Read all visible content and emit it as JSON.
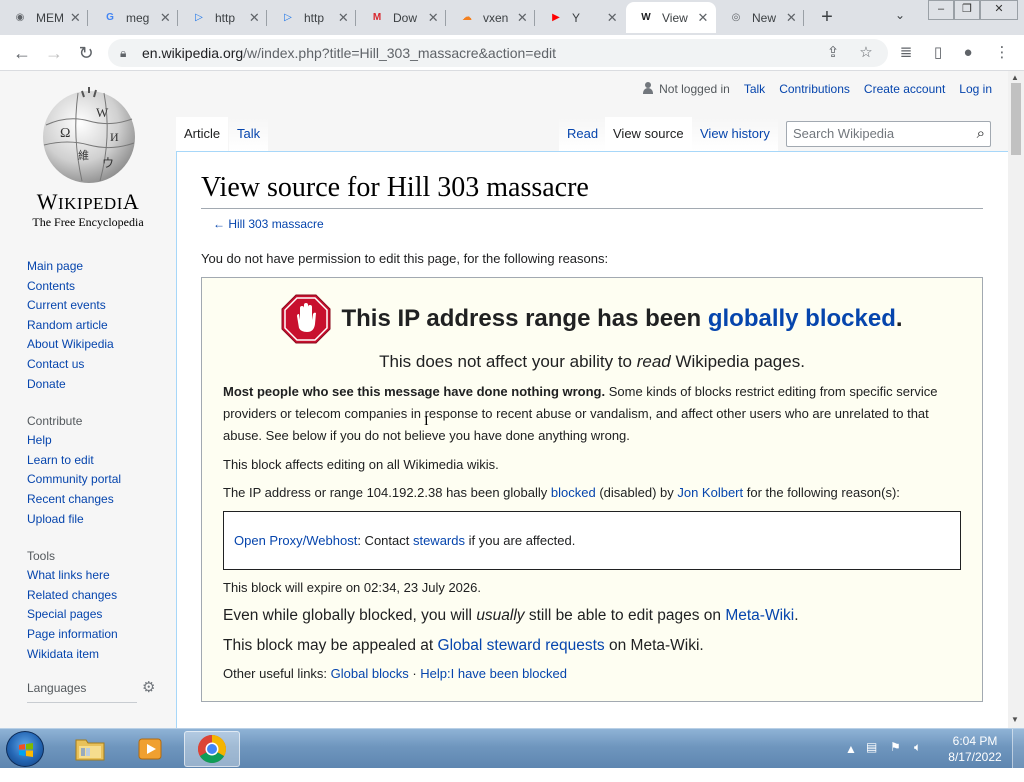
{
  "browser": {
    "tabs": [
      {
        "title": "MEM",
        "favicon": "github-icon",
        "color": "#5f6368",
        "glyph": "◉"
      },
      {
        "title": "meg",
        "favicon": "google-icon",
        "color": "#4285f4",
        "glyph": "G"
      },
      {
        "title": "http",
        "favicon": "play-icon",
        "color": "#1a73e8",
        "glyph": "▷"
      },
      {
        "title": "http",
        "favicon": "play-icon",
        "color": "#1a73e8",
        "glyph": "▷"
      },
      {
        "title": "Dow",
        "favicon": "mega-icon",
        "color": "#d9272e",
        "glyph": "M"
      },
      {
        "title": "vxen",
        "favicon": "cloudflare-icon",
        "color": "#f38020",
        "glyph": "☁"
      },
      {
        "title": "Y",
        "favicon": "youtube-icon",
        "color": "#ff0000",
        "glyph": "▶"
      },
      {
        "title": "View",
        "favicon": "wikipedia-icon",
        "color": "#202124",
        "glyph": "W"
      },
      {
        "title": "New",
        "favicon": "chrome-icon",
        "color": "#5f6368",
        "glyph": "◎"
      }
    ],
    "active_tab_index": 7,
    "url_host": "en.wikipedia.org",
    "url_rest": "/w/index.php?title=Hill_303_massacre&action=edit"
  },
  "wiki": {
    "personal": {
      "not_logged_in": "Not logged in",
      "talk": "Talk",
      "contributions": "Contributions",
      "create_account": "Create account",
      "log_in": "Log in"
    },
    "logo": {
      "wordmark_big": "W",
      "wordmark_rest": "IKIPEDI",
      "wordmark_a": "A",
      "tagline": "The Free Encyclopedia"
    },
    "nav": {
      "main": [
        "Main page",
        "Contents",
        "Current events",
        "Random article",
        "About Wikipedia",
        "Contact us",
        "Donate"
      ],
      "contribute_heading": "Contribute",
      "contribute": [
        "Help",
        "Learn to edit",
        "Community portal",
        "Recent changes",
        "Upload file"
      ],
      "tools_heading": "Tools",
      "tools": [
        "What links here",
        "Related changes",
        "Special pages",
        "Page information",
        "Wikidata item"
      ],
      "languages_heading": "Languages"
    },
    "tabs": {
      "article": "Article",
      "talk": "Talk",
      "read": "Read",
      "view_source": "View source",
      "view_history": "View history"
    },
    "search_placeholder": "Search Wikipedia",
    "title": "View source for Hill 303 massacre",
    "backlink": "← Hill 303 massacre",
    "intro": "You do not have permission to edit this page, for the following reasons:",
    "block": {
      "headline_pre": "This IP address range has been ",
      "headline_link": "globally blocked",
      "headline_post": ".",
      "sub_pre": "This does not affect your ability to ",
      "sub_em": "read",
      "sub_post": " Wikipedia pages.",
      "p1_bold": "Most people who see this message have done nothing wrong.",
      "p1_rest": " Some kinds of blocks restrict editing from specific service providers or telecom companies in response to recent abuse or vandalism, and affect other users who are unrelated to that abuse. See below if you do not believe you have done anything wrong.",
      "p2": "This block affects editing on all Wikimedia wikis.",
      "p3_pre": "The IP address or range 104.192.2.38 has been globally ",
      "p3_link1": "blocked",
      "p3_mid": " (disabled) by ",
      "p3_link2": "Jon Kolbert",
      "p3_post": " for the following reason(s):",
      "reason_link1": "Open Proxy/Webhost",
      "reason_mid": ": Contact ",
      "reason_link2": "stewards",
      "reason_post": " if you are affected.",
      "expire": "This block will expire on 02:34, 23 July 2026.",
      "edit_pre": "Even while globally blocked, you will ",
      "edit_em": "usually",
      "edit_mid": " still be able to edit pages on ",
      "edit_link": "Meta-Wiki",
      "edit_post": ".",
      "appeal_pre": "This block may be appealed at ",
      "appeal_link": "Global steward requests",
      "appeal_post": " on Meta-Wiki.",
      "useful_pre": "Other useful links: ",
      "useful_link1": "Global blocks",
      "useful_sep": " · ",
      "useful_link2": "Help:I have been blocked"
    }
  },
  "taskbar": {
    "time": "6:04 PM",
    "date": "8/17/2022"
  }
}
